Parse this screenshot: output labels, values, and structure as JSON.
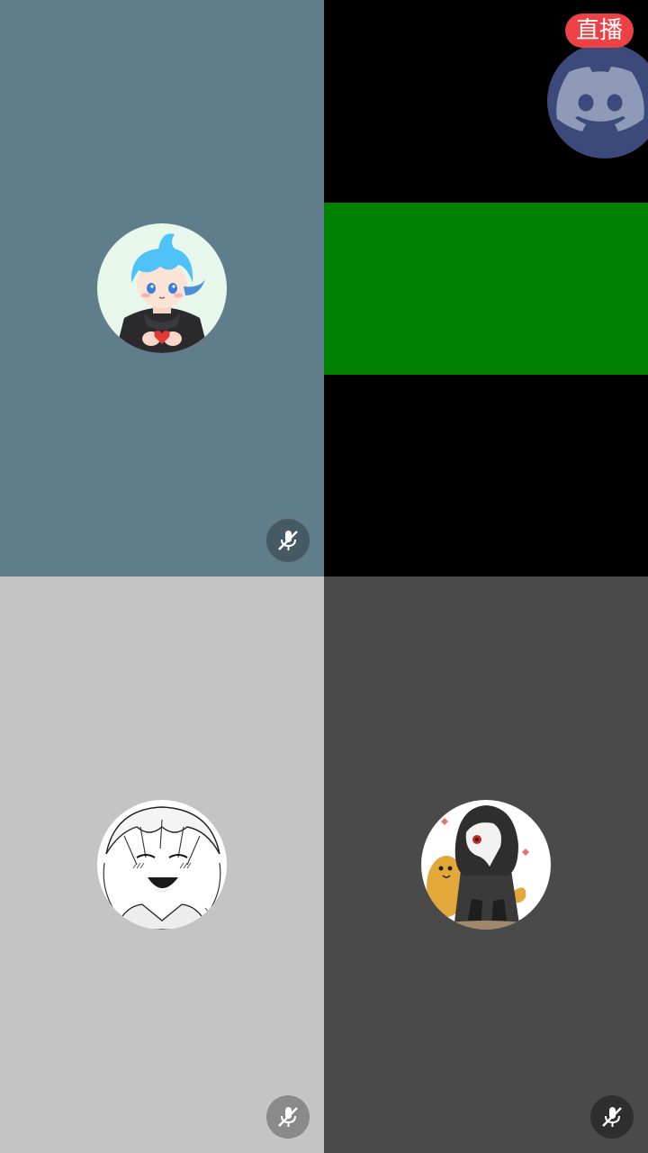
{
  "live_badge": {
    "label": "直播",
    "color": "#ED4245"
  },
  "tiles": [
    {
      "position": "top-left",
      "background": "#607D8B",
      "avatar": "anime-boy-blue-hair-heart-avatar",
      "muted": true,
      "mute_button_color": "#455A64"
    },
    {
      "position": "top-right",
      "background": "#000000",
      "stream_color": "#008000",
      "avatar": "discord-logo-avatar",
      "avatar_color": "#3B4A7A",
      "is_streaming": true
    },
    {
      "position": "bottom-left",
      "background": "#C4C4C4",
      "avatar": "manga-smiling-character-avatar",
      "muted": true,
      "mute_button_color": "#8A8A8A"
    },
    {
      "position": "bottom-right",
      "background": "#4A4A4A",
      "avatar": "plague-doctor-character-avatar",
      "muted": true,
      "mute_button_color": "#2E2E2E"
    }
  ],
  "icons": {
    "mute": "microphone-muted-icon",
    "discord": "discord-logo-icon"
  }
}
